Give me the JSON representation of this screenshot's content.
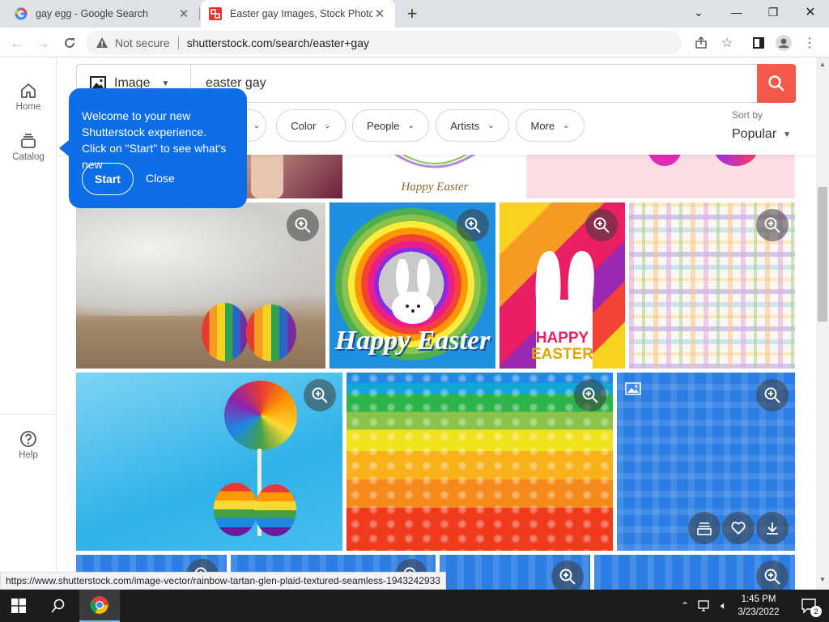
{
  "browser": {
    "tabs": [
      {
        "title": "gay egg - Google Search",
        "active": false
      },
      {
        "title": "Easter gay Images, Stock Photos",
        "active": true
      }
    ],
    "new_tab": "+",
    "security_label": "Not secure",
    "url": "shutterstock.com/search/easter+gay",
    "status_url": "https://www.shutterstock.com/image-vector/rainbow-tartan-glen-plaid-textured-seamless-1943242933"
  },
  "sidebar": {
    "items": [
      {
        "label": "Home"
      },
      {
        "label": "Catalog"
      },
      {
        "label": "Help"
      }
    ]
  },
  "search": {
    "type_label": "Image",
    "query": "easter gay"
  },
  "filters": [
    "Color",
    "People",
    "Artists",
    "More"
  ],
  "sort": {
    "label": "Sort by",
    "value": "Popular"
  },
  "tooltip": {
    "message": "Welcome to your new Shutterstock experience. Click on \"Start\" to see what's new",
    "start_label": "Start",
    "close_label": "Close"
  },
  "images": {
    "happy_easter_top": "Happy Easter",
    "happy_easter_script": "Happy Easter",
    "happy_word": "HAPPY",
    "easter_word": "EASTER"
  },
  "taskbar": {
    "time": "1:45 PM",
    "date": "3/23/2022",
    "notifications": "2"
  },
  "colors": {
    "accent": "#f2594b",
    "tooltip": "#0d6ee8"
  }
}
